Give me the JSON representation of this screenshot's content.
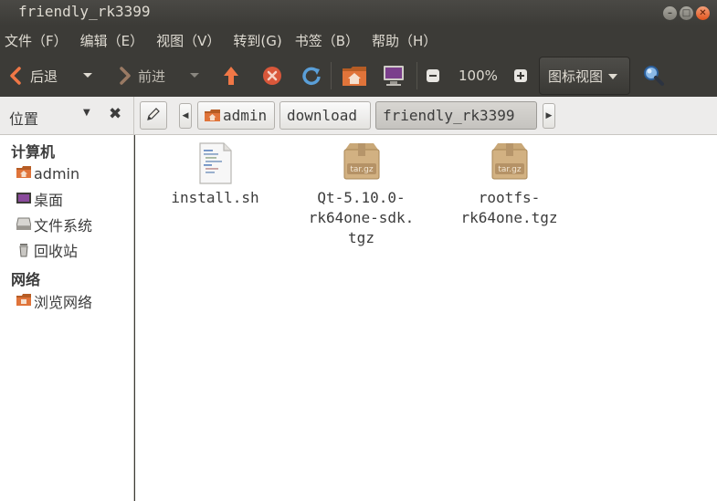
{
  "window": {
    "title": "friendly_rk3399"
  },
  "menu": [
    "文件（F）",
    "编辑（E）",
    "视图（V）",
    "转到(G)",
    "书签（B）",
    "帮助（H）"
  ],
  "toolbar": {
    "back_label": "后退",
    "forward_label": "前进",
    "zoom_level": "100%",
    "view_mode": "图标视图"
  },
  "location": {
    "sidebar_title": "位置",
    "breadcrumbs": [
      "admin",
      "download",
      "friendly_rk3399"
    ]
  },
  "sidebar": {
    "sections": [
      {
        "title": "计算机",
        "items": [
          "admin",
          "桌面",
          "文件系统",
          "回收站"
        ]
      },
      {
        "title": "网络",
        "items": [
          "浏览网络"
        ]
      }
    ]
  },
  "files": [
    {
      "name": "install.sh",
      "type": "script-file-icon"
    },
    {
      "name": "Qt-5.10.0-\nrk64one-sdk.\ntgz",
      "type": "archive-icon",
      "badge": "tar.gz"
    },
    {
      "name": "rootfs-\nrk64one.tgz",
      "type": "archive-icon",
      "badge": "tar.gz"
    }
  ],
  "colors": {
    "titlebar": "#3c3b37",
    "accent": "#e2541d",
    "home_folder": "#e0743a"
  }
}
